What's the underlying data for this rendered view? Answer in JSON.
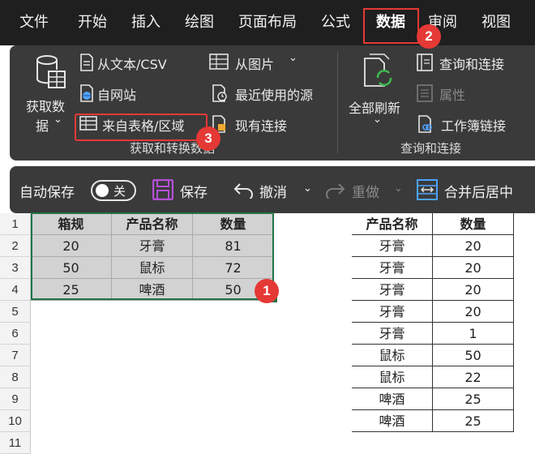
{
  "menu": {
    "tabs": [
      "文件",
      "开始",
      "插入",
      "绘图",
      "页面布局",
      "公式",
      "数据",
      "审阅",
      "视图"
    ],
    "active_tab": "数据"
  },
  "ribbon": {
    "get_data": {
      "line1": "获取数",
      "line2": "据"
    },
    "from_text_csv": "从文本/CSV",
    "from_web": "自网站",
    "from_table": "来自表格/区域",
    "from_picture": "从图片",
    "recent_sources": "最近使用的源",
    "existing_connections": "现有连接",
    "group_get_transform": "获取和转换数据",
    "refresh_all": "全部刷新",
    "queries_connections": "查询和连接",
    "properties": "属性",
    "workbook_links": "工作簿链接",
    "group_queries": "查询和连接"
  },
  "qat": {
    "autosave": "自动保存",
    "toggle_state": "关",
    "save": "保存",
    "undo": "撤消",
    "redo": "重做",
    "merge_center": "合并后居中"
  },
  "sheet": {
    "row_numbers": [
      "1",
      "2",
      "3",
      "4",
      "5",
      "6",
      "7",
      "8",
      "9",
      "10",
      "11"
    ],
    "left_table": {
      "headers": [
        "箱规",
        "产品名称",
        "数量"
      ],
      "rows": [
        [
          "20",
          "牙膏",
          "81"
        ],
        [
          "50",
          "鼠标",
          "72"
        ],
        [
          "25",
          "啤酒",
          "50"
        ]
      ]
    },
    "right_table": {
      "headers": [
        "产品名称",
        "数量"
      ],
      "rows": [
        [
          "牙膏",
          "20"
        ],
        [
          "牙膏",
          "20"
        ],
        [
          "牙膏",
          "20"
        ],
        [
          "牙膏",
          "20"
        ],
        [
          "牙膏",
          "1"
        ],
        [
          "鼠标",
          "50"
        ],
        [
          "鼠标",
          "22"
        ],
        [
          "啤酒",
          "25"
        ],
        [
          "啤酒",
          "25"
        ]
      ]
    }
  },
  "badges": {
    "one": "1",
    "two": "2",
    "three": "3"
  },
  "colors": {
    "highlight": "#e53935",
    "selection": "#217346",
    "ribbon_bg": "#3a3a3a",
    "accent_purple": "#b44fd6"
  }
}
